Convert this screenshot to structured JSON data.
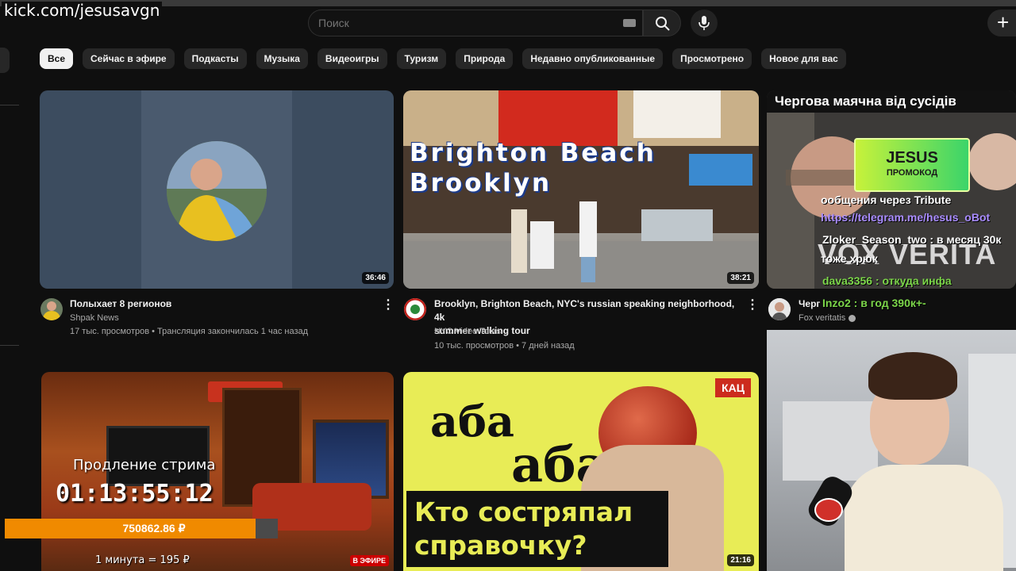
{
  "overlay": {
    "url": "kick.com/jesusavgn"
  },
  "header": {
    "search_placeholder": "Поиск"
  },
  "chips": [
    "Все",
    "Сейчас в эфире",
    "Подкасты",
    "Музыка",
    "Видеоигры",
    "Туризм",
    "Природа",
    "Недавно опубликованные",
    "Просмотрено",
    "Новое для вас"
  ],
  "videos": [
    {
      "title": "Полыхает 8 регионов",
      "channel": "Shpak News",
      "stats": "17 тыс. просмотров • Трансляция закончилась 1 час назад",
      "duration": "36:46"
    },
    {
      "title_line1": "Brooklyn, Brighton Beach, NYC's russian speaking neighborhood, 4k",
      "title_line2": "summer walking tour",
      "channel": "NYC Video Tours",
      "stats": "10 тыс. просмотров • 7 дней назад",
      "duration": "38:21",
      "thumb_text_line1": "Brighton Beach",
      "thumb_text_line2": "Brooklyn"
    },
    {
      "title": "Черг",
      "channel": "Fox veritatis",
      "thumb_header": "Чергова маячна від сусідів"
    },
    {
      "live_badge": "В ЭФИРЕ"
    },
    {
      "duration": "21:16",
      "badge": "КАЦ",
      "thumb_caption_line1": "Кто состряпал",
      "thumb_caption_line2": "справочку?",
      "thumb_letters": "аба"
    }
  ],
  "stream_overlay": {
    "promo_title": "JESUS",
    "promo_subtitle": "ПРОМОКОД",
    "chat": [
      {
        "text": "ообщения через Tribute",
        "color": "#ffffff"
      },
      {
        "text": "https://telegram.me/hesus_oBot",
        "color": "#a98cff"
      },
      {
        "text": "Zloker_Season_two : в месяц 30к",
        "color": "#ffffff"
      },
      {
        "text": "тоже хрюк",
        "color": "#ffffff"
      },
      {
        "text": "dava3356 : откуда инфа",
        "color": "#7cd64a"
      },
      {
        "text": "Inzo2 : в год 390к+-",
        "color": "#7cd64a"
      }
    ],
    "vox_watermark": "VOX VERITA",
    "extension_label": "Продление стрима",
    "timer": "01:13:55:12",
    "donation_total": "750862.86 ₽",
    "donation_progress": 0.92,
    "rate": "1 минута = 195 ₽"
  }
}
